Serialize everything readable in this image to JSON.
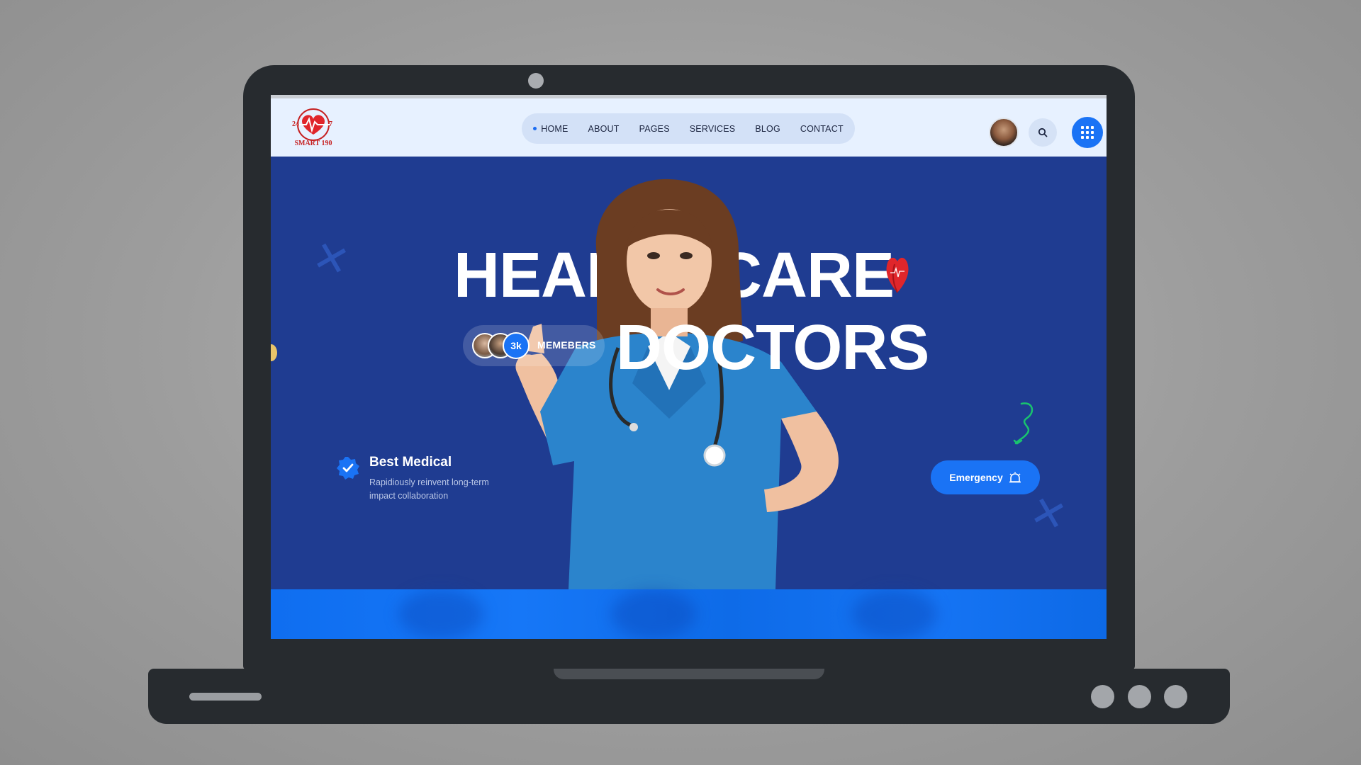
{
  "brand": {
    "logo_name": "SMART 190",
    "logo_left": "24",
    "logo_right": "7"
  },
  "nav": {
    "items": [
      {
        "label": "HOME",
        "active": true
      },
      {
        "label": "ABOUT",
        "active": false
      },
      {
        "label": "PAGES",
        "active": false
      },
      {
        "label": "SERVICES",
        "active": false
      },
      {
        "label": "BLOG",
        "active": false
      },
      {
        "label": "CONTACT",
        "active": false
      }
    ]
  },
  "header_actions": {
    "icons": [
      "avatar",
      "search-icon",
      "grid-menu-icon"
    ]
  },
  "hero": {
    "line1_part1": "HEAL",
    "line1_part2": "CARE",
    "line2": "DOCTORS",
    "members": {
      "count": "3k",
      "label": "MEMEBERS"
    },
    "feature": {
      "title": "Best Medical",
      "description": "Rapidiously reinvent long-term impact collaboration"
    },
    "cta_label": "Emergency"
  },
  "colors": {
    "hero_bg": "#1f3c91",
    "accent": "#1a73f5",
    "nav_bg": "#e7f1ff",
    "heart": "#e0262b",
    "squiggle": "#19c46e"
  }
}
